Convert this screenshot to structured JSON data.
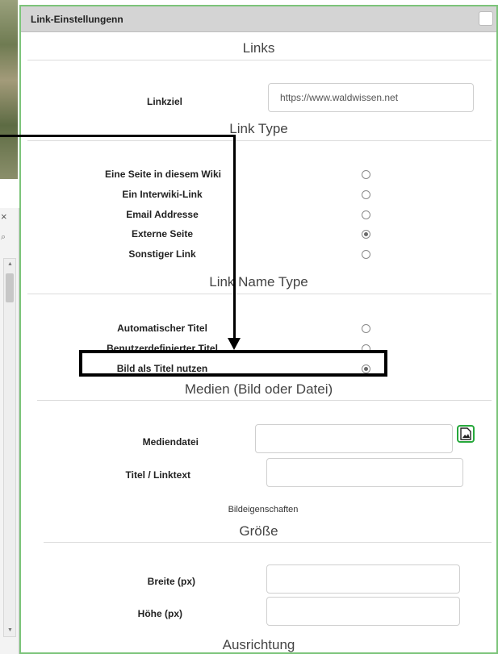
{
  "dialog": {
    "title": "Link-Einstellungenn"
  },
  "links": {
    "heading": "Links",
    "target_label": "Linkziel",
    "target_value": "https://www.waldwissen.net"
  },
  "link_type": {
    "heading": "Link Type",
    "options": [
      {
        "label": "Eine Seite in diesem Wiki",
        "checked": false
      },
      {
        "label": "Ein Interwiki-Link",
        "checked": false
      },
      {
        "label": "Email Addresse",
        "checked": false
      },
      {
        "label": "Externe Seite",
        "checked": true
      },
      {
        "label": "Sonstiger Link",
        "checked": false
      }
    ]
  },
  "link_name_type": {
    "heading": "Link Name Type",
    "options": [
      {
        "label": "Automatischer Titel",
        "checked": false
      },
      {
        "label": "Benutzerdefinierter Titel",
        "checked": false
      },
      {
        "label": "Bild als Titel nutzen",
        "checked": true
      }
    ]
  },
  "media": {
    "heading": "Medien (Bild oder Datei)",
    "file_label": "Mediendatei",
    "file_value": "",
    "title_label": "Titel / Linktext",
    "title_value": "",
    "image_props_label": "Bildeigenschaften"
  },
  "size": {
    "heading": "Größe",
    "width_label": "Breite (px)",
    "width_value": "",
    "height_label": "Höhe (px)",
    "height_value": ""
  },
  "alignment": {
    "heading": "Ausrichtung"
  },
  "background_panel": {
    "close_glyph": "×"
  },
  "colors": {
    "dialog_border": "#7cc47a",
    "media_button": "#27a83c",
    "annotation": "#000000"
  }
}
